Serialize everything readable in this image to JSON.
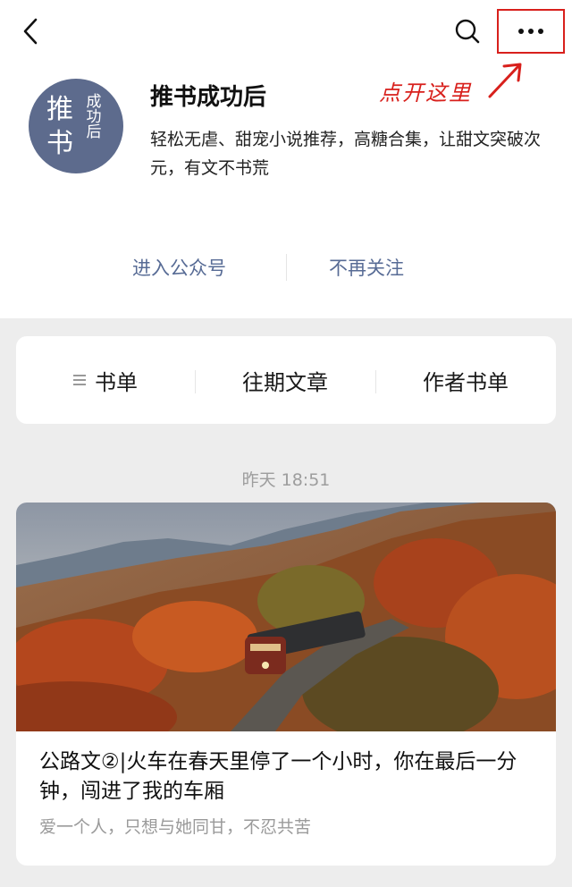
{
  "header": {
    "annotation": "点开这里",
    "accent_red": "#d8201c",
    "back_icon": "chevron-left-icon",
    "search_icon": "search-icon",
    "more_icon": "more-dots-icon"
  },
  "account": {
    "avatar_big_1": "推",
    "avatar_big_2": "书",
    "avatar_small": "成功后",
    "name": "推书成功后",
    "description": "轻松无虐、甜宠小说推荐，高糖合集，让甜文突破次元，有文不书荒",
    "avatar_color": "#5d6b8d"
  },
  "actions": {
    "enter_label": "进入公众号",
    "unfollow_label": "不再关注",
    "link_color": "#576b95"
  },
  "menu": {
    "items": [
      {
        "label": "书单",
        "icon": "list-icon"
      },
      {
        "label": "往期文章"
      },
      {
        "label": "作者书单"
      }
    ]
  },
  "feed": {
    "timestamp": "昨天 18:51",
    "article": {
      "title": "公路文②|火车在春天里停了一个小时，你在最后一分钟，闯进了我的车厢",
      "subtitle": "爱一个人，只想与她同甘，不忍共苦"
    }
  }
}
